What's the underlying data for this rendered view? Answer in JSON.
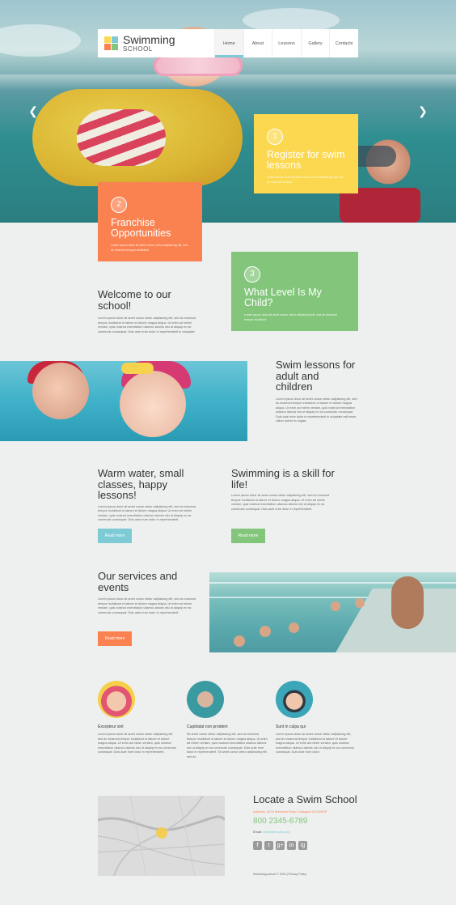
{
  "colors": {
    "yellow": "#fbd84f",
    "orange": "#fa8250",
    "green": "#83c67b",
    "teal": "#7ecad5"
  },
  "brand": {
    "title": "Swimming",
    "subtitle": "SCHOOL"
  },
  "nav": {
    "items": [
      "Home",
      "About",
      "Lessons",
      "Gallery",
      "Contacts"
    ],
    "active": "Home"
  },
  "slider": {
    "prev_icon": "chevron-left-icon",
    "next_icon": "chevron-right-icon"
  },
  "boxes": [
    {
      "num": "1",
      "title": "Register for swim lessons",
      "text": "Lorem ipsum dolor sit amet conse ctetur adipisicing elit, sed do eiusmod tempor"
    },
    {
      "num": "2",
      "title": "Franchise Opportunities",
      "text": "Lorem ipsum dolor sit amet conse ctetur adipisicing elit, sed do eiusmod tempor incididunt"
    },
    {
      "num": "3",
      "title": "What Level Is My Child?",
      "text": "Lorem ipsum dolor sit amet conse ctetur adipisicing elit, sed do eiusmod tempor incididunt"
    }
  ],
  "welcome": {
    "title": "Welcome to our school!",
    "text": "Lorem ipsum dolor sit amet conse ctetur adipisicing elit, sed do eiusmod tempor incididunt ut labore et dolore magna aliqua. Ut enim ad minim veniam, quis nostrud exercitation ullamco laboris nisi ut aliquip ex ea commodo consequat. Duis aute irure dolor in reprehenderit in voluptate."
  },
  "swim_lessons": {
    "title": "Swim lessons for adult and children",
    "text": "Lorem ipsum dolor sit amet conse ctetur adipisicing elit, sed do eiusmod tempor incididunt ut labore et dolore magna aliqua. Ut enim ad minim veniam, quis nostrud exercitation ullamco laboris nisi ut aliquip ex ea commodo consequat. Duis aute irure dolor in reprehenderit in voluptate velit esse cillum dolore eu fugiat."
  },
  "warm": {
    "title": "Warm water, small classes, happy lessons!",
    "text": "Lorem ipsum dolor sit amet conse ctetur adipisicing elit, sed do eiusmod tempor incididunt ut labore et dolore magna aliqua. Ut enim ad minim veniam, quis nostrud exercitation ullamco laboris nisi ut aliquip ex ea commodo consequat. Duis aute irure dolor in reprehenderit.",
    "button": "Read more"
  },
  "skill": {
    "title": "Swimming is a skill for life!",
    "text": "Lorem ipsum dolor sit amet conse ctetur adipisicing elit, sed do eiusmod tempor incididunt ut labore et dolore magna aliqua. Ut enim ad minim veniam, quis nostrud exercitation ullamco laboris nisi ut aliquip ex ea commodo consequat. Duis aute irure dolor in reprehenderit.",
    "button": "Read more"
  },
  "services": {
    "title": "Our services and events",
    "text": "Lorem ipsum dolor sit amet conse ctetur adipisicing elit, sed do eiusmod tempor incididunt ut labore et dolore magna aliqua. Ut enim ad minim veniam, quis nostrud exercitation ullamco laboris nisi ut aliquip ex ea commodo consequat. Duis aute irure dolor in reprehenderit.",
    "button": "Read more"
  },
  "features": [
    {
      "title": "Excepteur sint",
      "text": "Lorem ipsum dolor sit amet conse ctetur adipisicing elit, sed do eiusmod tempor incididunt ut labore et dolore magna aliqua. Ut enim ad minim veniam, quis nostrud exercitation ullamco laboris nisi ut aliquip ex ea commodo consequat. Duis aute irure dolor in reprehenderit."
    },
    {
      "title": "Cupidatat non proident",
      "text": "Sit amet conse ctetur adipisicing elit, sed do eiusmod tempor incididunt ut labore et dolore magna aliqua. Ut enim ad minim veniam, quis nostrud exercitation ullamco laboris nisi ut aliquip ex ea commodo consequat. Duis aute irure dolor in reprehenderit. Sit amet conse ctetur adipisicing elit, sed do."
    },
    {
      "title": "Sunt in culpa qui",
      "text": "Lorem ipsum dolor sit amet conse ctetur adipisicing elit, sed do eiusmod tempor incididunt ut labore et dolore magna aliqua. Ut enim ad minim veniam, quis nostrud exercitation ullamco laboris nisi ut aliquip ex ea commodo consequat. Duis aute irure dolor."
    }
  ],
  "locate": {
    "title": "Locate a Swim School",
    "address": "Address: 4578 Marmora Road, Glasgow D04 89GR",
    "phone": "800 2345-6789",
    "email_label": "Email:",
    "email": "info@demolink.org"
  },
  "socials": [
    "f",
    "t",
    "g+",
    "in",
    "ig"
  ],
  "footer": {
    "copyright": "Swimming school © 2015 | Privacy Policy"
  }
}
